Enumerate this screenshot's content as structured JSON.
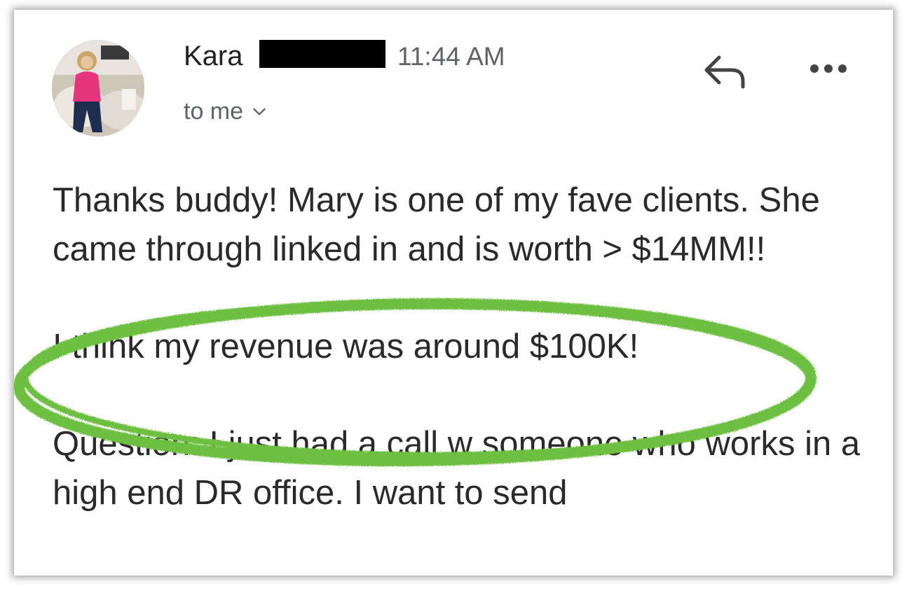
{
  "email": {
    "sender_name": "Kara",
    "time": "11:44 AM",
    "recipient_label": "to me",
    "paragraphs": [
      "Thanks buddy! Mary is one of my fave clients. She came through linked in and is worth > $14MM!!",
      "I think my revenue was around $100K!",
      "Question: I just had a call w someone who works in a high end DR office. I want to send"
    ]
  },
  "highlight": {
    "color": "#6cbf3f"
  },
  "icons": {
    "reply": "reply-icon",
    "more": "more-horizontal-icon",
    "recipient_expand": "chevron-down-icon"
  }
}
